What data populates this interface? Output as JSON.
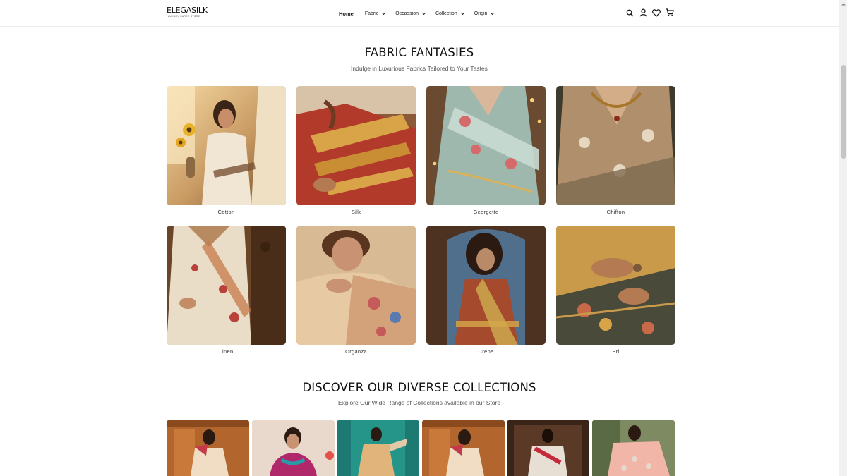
{
  "header": {
    "logo_text": "ELEGASILK",
    "logo_tagline": "LUXURY SAREE STORE",
    "nav": [
      {
        "label": "Home"
      },
      {
        "label": "Fabric"
      },
      {
        "label": "Occassion"
      },
      {
        "label": "Collection"
      },
      {
        "label": "Origin"
      }
    ],
    "icons": [
      "search-icon",
      "user-icon",
      "heart-icon",
      "cart-icon"
    ]
  },
  "fabric_section": {
    "title": "FABRIC FANTASIES",
    "subtitle": "Indulge in Luxurious Fabrics Tailored to Your Tastes",
    "items": [
      {
        "label": "Cotton"
      },
      {
        "label": "Silk"
      },
      {
        "label": "Georgette"
      },
      {
        "label": "Chiffon"
      },
      {
        "label": "Linen"
      },
      {
        "label": "Organza"
      },
      {
        "label": "Crepe"
      },
      {
        "label": "Eri"
      }
    ]
  },
  "collections_section": {
    "title": "DISCOVER OUR DIVERSE COLLECTIONS",
    "subtitle": "Explore Our Wide Range of Collections available in our Store"
  },
  "colors": {
    "header_bg": "#ffffff",
    "text": "#111111",
    "muted": "#555555"
  }
}
